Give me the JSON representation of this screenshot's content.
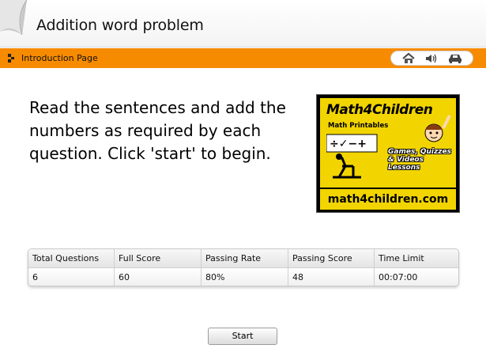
{
  "header": {
    "title": "Addition word problem"
  },
  "nav": {
    "label": "Introduction Page",
    "tools": [
      "home-icon",
      "speaker-icon",
      "car-icon"
    ],
    "accent_color": "#f78b00"
  },
  "intro": {
    "text": "Read the sentences and add the numbers as required by each question. Click 'start' to begin."
  },
  "logo": {
    "name": "Math4Children",
    "subtitle": "Math Printables",
    "tagline": "Games, Quizzes & Videos Lessons",
    "url": "math4children.com"
  },
  "info": {
    "headers": [
      "Total Questions",
      "Full Score",
      "Passing Rate",
      "Passing Score",
      "Time Limit"
    ],
    "values": [
      "6",
      "60",
      "80%",
      "48",
      "00:07:00"
    ]
  },
  "start_button": {
    "label": "Start"
  }
}
